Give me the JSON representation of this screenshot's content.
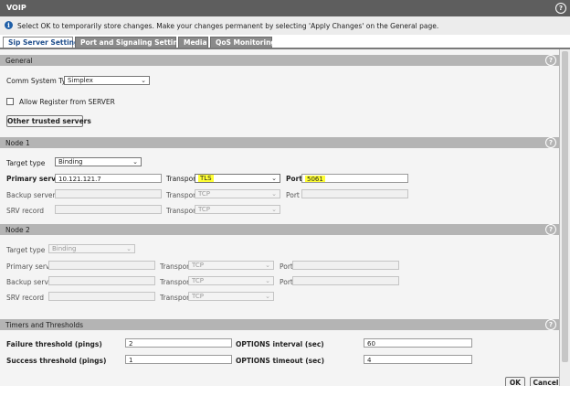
{
  "window": {
    "title": "VOIP"
  },
  "info": {
    "message": "Select OK to temporarily store changes. Make your changes permanent by selecting 'Apply Changes' on the General page."
  },
  "tabs": [
    {
      "label": "Sip Server Settings",
      "active": true
    },
    {
      "label": "Port and Signaling Settings",
      "active": false
    },
    {
      "label": "Media",
      "active": false
    },
    {
      "label": "QoS Monitoring",
      "active": false
    }
  ],
  "general": {
    "title": "General",
    "comm_system_type_label": "Comm System Type",
    "comm_system_type_value": "Simplex",
    "allow_register_label": "Allow Register from SERVER",
    "allow_register_checked": false,
    "other_trusted_button": "Other trusted servers"
  },
  "node1": {
    "title": "Node 1",
    "target_type_label": "Target type",
    "target_type_value": "Binding",
    "primary_label": "Primary server",
    "primary_value": "10.121.121.7",
    "primary_transport_label": "Transport",
    "primary_transport_value": "TLS",
    "primary_port_label": "Port",
    "primary_port_value": "5061",
    "backup_label": "Backup server",
    "backup_value": "",
    "backup_transport_label": "Transport",
    "backup_transport_value": "TCP",
    "backup_port_label": "Port",
    "backup_port_value": "",
    "srv_label": "SRV record",
    "srv_value": "",
    "srv_transport_label": "Transport",
    "srv_transport_value": "TCP"
  },
  "node2": {
    "title": "Node 2",
    "target_type_label": "Target type",
    "target_type_value": "Binding",
    "primary_label": "Primary server",
    "primary_value": "",
    "primary_transport_label": "Transport",
    "primary_transport_value": "TCP",
    "primary_port_label": "Port",
    "primary_port_value": "",
    "backup_label": "Backup server",
    "backup_value": "",
    "backup_transport_label": "Transport",
    "backup_transport_value": "TCP",
    "backup_port_label": "Port",
    "backup_port_value": "",
    "srv_label": "SRV record",
    "srv_value": "",
    "srv_transport_label": "Transport",
    "srv_transport_value": "TCP"
  },
  "timers": {
    "title": "Timers and Thresholds",
    "failure_label": "Failure threshold (pings)",
    "failure_value": "2",
    "options_interval_label": "OPTIONS interval (sec)",
    "options_interval_value": "60",
    "success_label": "Success threshold (pings)",
    "success_value": "1",
    "options_timeout_label": "OPTIONS timeout (sec)",
    "options_timeout_value": "4"
  },
  "buttons": {
    "ok": "OK",
    "cancel": "Cancel"
  },
  "icons": {
    "help": "help-icon",
    "info": "info-icon",
    "chevron": "chevron-down-icon"
  },
  "colors": {
    "title_bg": "#5e5e5e",
    "section_bg": "#b4b4b4",
    "highlight": "#ffff33",
    "active_tab_text": "#1f4e8c",
    "info_icon": "#1f5fa8"
  }
}
